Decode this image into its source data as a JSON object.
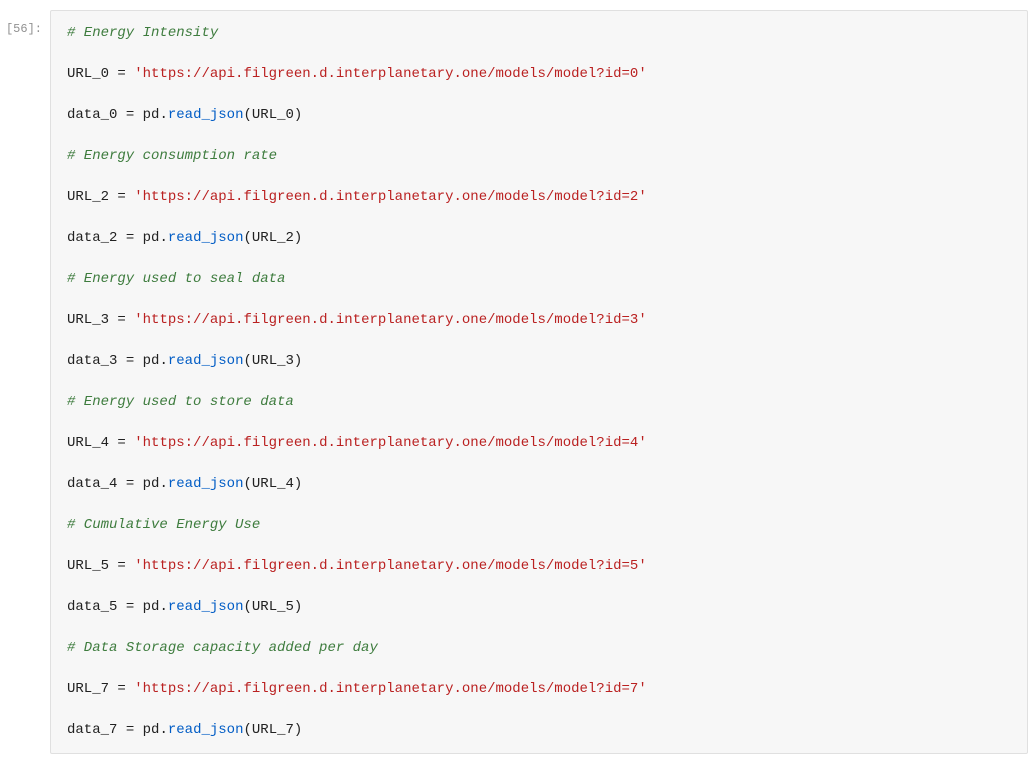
{
  "prompt": "[56]:",
  "code": {
    "items": [
      {
        "comment": "# Energy Intensity",
        "url_var": "URL_0",
        "url_val": "'https://api.filgreen.d.interplanetary.one/models/model?id=0'",
        "data_var": "data_0",
        "pd": "pd",
        "method": "read_json",
        "arg": "URL_0"
      },
      {
        "comment": "# Energy consumption rate",
        "url_var": "URL_2",
        "url_val": "'https://api.filgreen.d.interplanetary.one/models/model?id=2'",
        "data_var": "data_2",
        "pd": "pd",
        "method": "read_json",
        "arg": "URL_2"
      },
      {
        "comment": "# Energy used to seal data",
        "url_var": "URL_3",
        "url_val": "'https://api.filgreen.d.interplanetary.one/models/model?id=3'",
        "data_var": "data_3",
        "pd": "pd",
        "method": "read_json",
        "arg": "URL_3"
      },
      {
        "comment": "# Energy used to store data",
        "url_var": "URL_4",
        "url_val": "'https://api.filgreen.d.interplanetary.one/models/model?id=4'",
        "data_var": "data_4",
        "pd": "pd",
        "method": "read_json",
        "arg": "URL_4"
      },
      {
        "comment": "# Cumulative Energy Use",
        "url_var": "URL_5",
        "url_val": "'https://api.filgreen.d.interplanetary.one/models/model?id=5'",
        "data_var": "data_5",
        "pd": "pd",
        "method": "read_json",
        "arg": "URL_5"
      },
      {
        "comment": "# Data Storage capacity added per day",
        "url_var": "URL_7",
        "url_val": "'https://api.filgreen.d.interplanetary.one/models/model?id=7'",
        "data_var": "data_7",
        "pd": "pd",
        "method": "read_json",
        "arg": "URL_7"
      }
    ],
    "eq": " = ",
    "dot": ".",
    "lparen": "(",
    "rparen": ")"
  }
}
